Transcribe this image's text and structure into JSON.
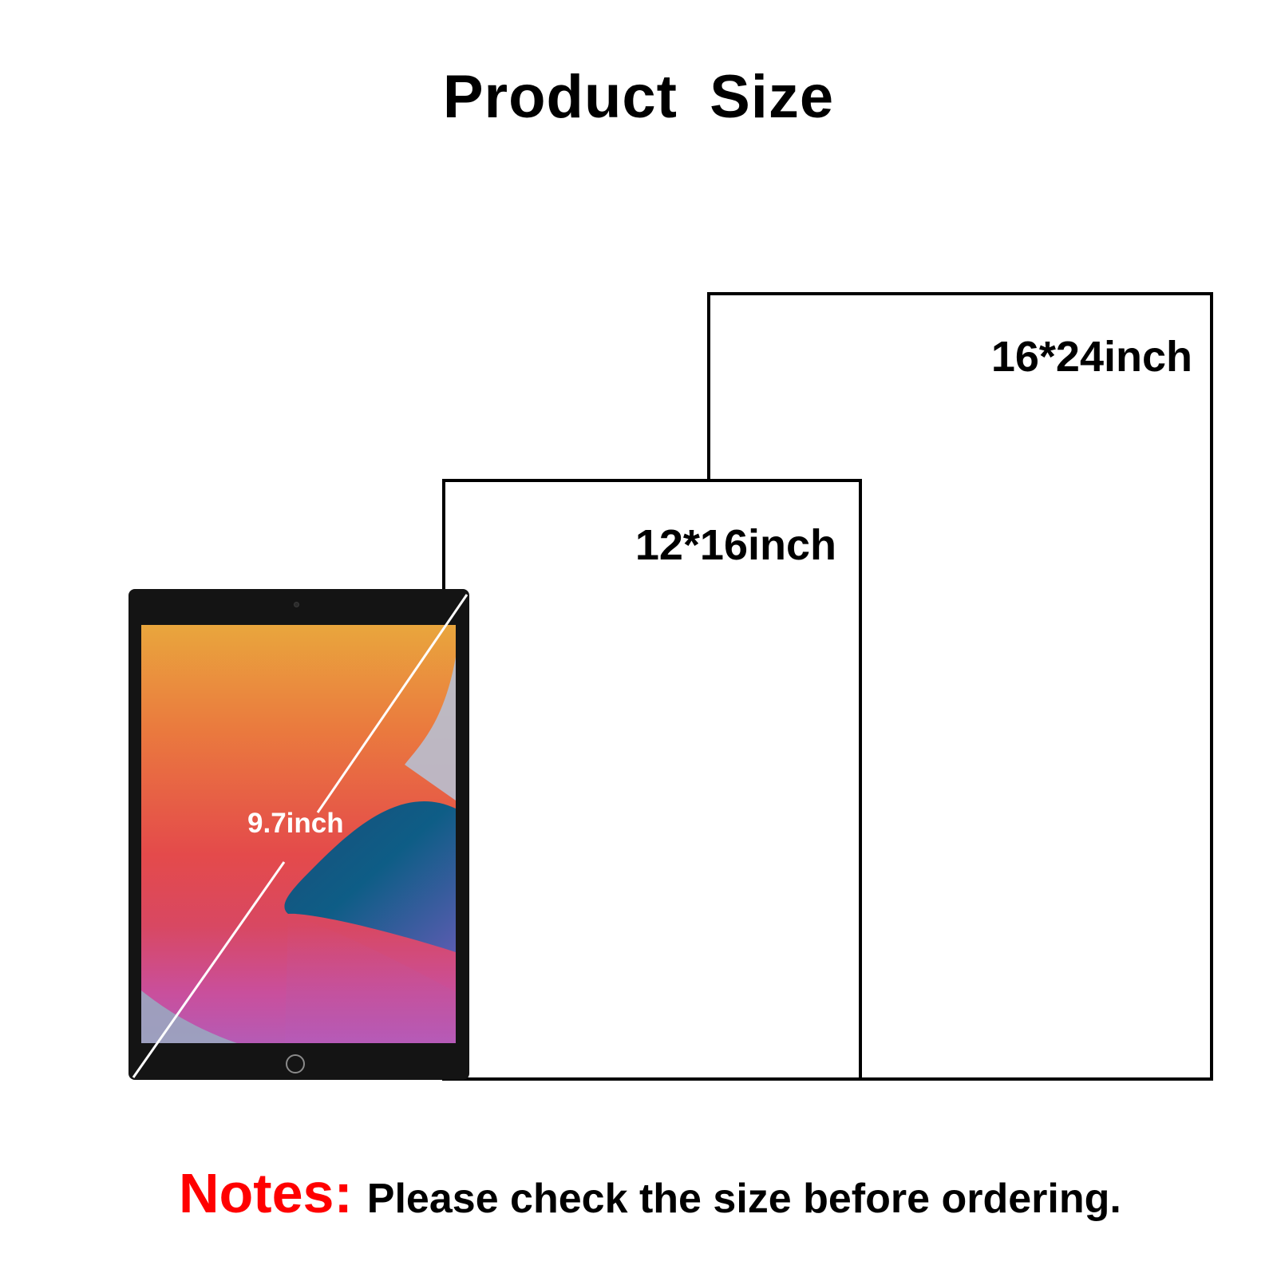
{
  "title": "Product  Size",
  "frames": {
    "large": {
      "label": "16*24inch"
    },
    "medium": {
      "label": "12*16inch"
    }
  },
  "tablet": {
    "diagonal_label": "9.7inch"
  },
  "notes": {
    "prefix": "Notes:",
    "text": "Please check the size before ordering."
  },
  "colors": {
    "notes_prefix": "#ff0000",
    "text": "#000000",
    "frame_border": "#000000",
    "tablet_bezel": "#141414"
  }
}
